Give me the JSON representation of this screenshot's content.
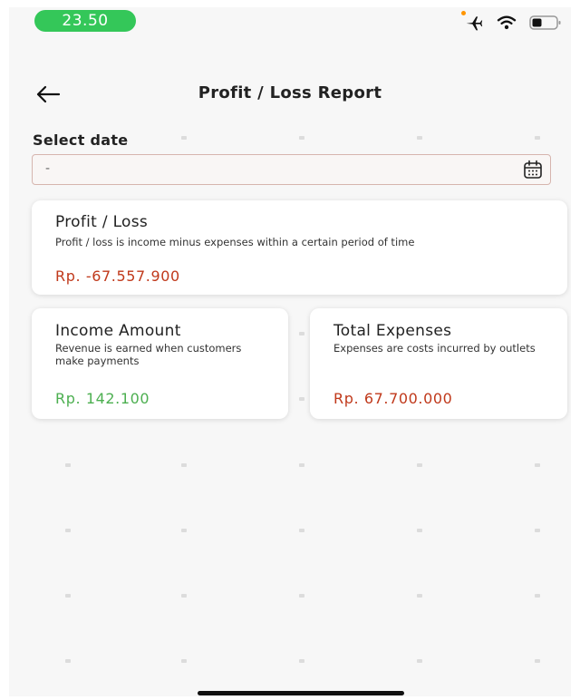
{
  "status_bar": {
    "time": "23.50"
  },
  "header": {
    "title": "Profit / Loss Report"
  },
  "date_filter": {
    "label": "Select date",
    "value": "-"
  },
  "profit_loss_card": {
    "title": "Profit / Loss",
    "description": "Profit / loss is income minus expenses within a certain period of time",
    "value": "Rp. -67.557.900"
  },
  "income_card": {
    "title": "Income Amount",
    "description": "Revenue is earned when customers make payments",
    "value": "Rp. 142.100"
  },
  "expenses_card": {
    "title": "Total Expenses",
    "description": "Expenses are costs incurred by outlets",
    "value": "Rp. 67.700.000"
  },
  "colors": {
    "accent_green": "#34c759",
    "negative_red": "#c0391b",
    "positive_green": "#4caf50",
    "input_border": "#d6b5ae"
  },
  "icons": [
    "airplane-icon",
    "wifi-icon",
    "battery-icon",
    "back-arrow-icon",
    "calendar-icon"
  ]
}
